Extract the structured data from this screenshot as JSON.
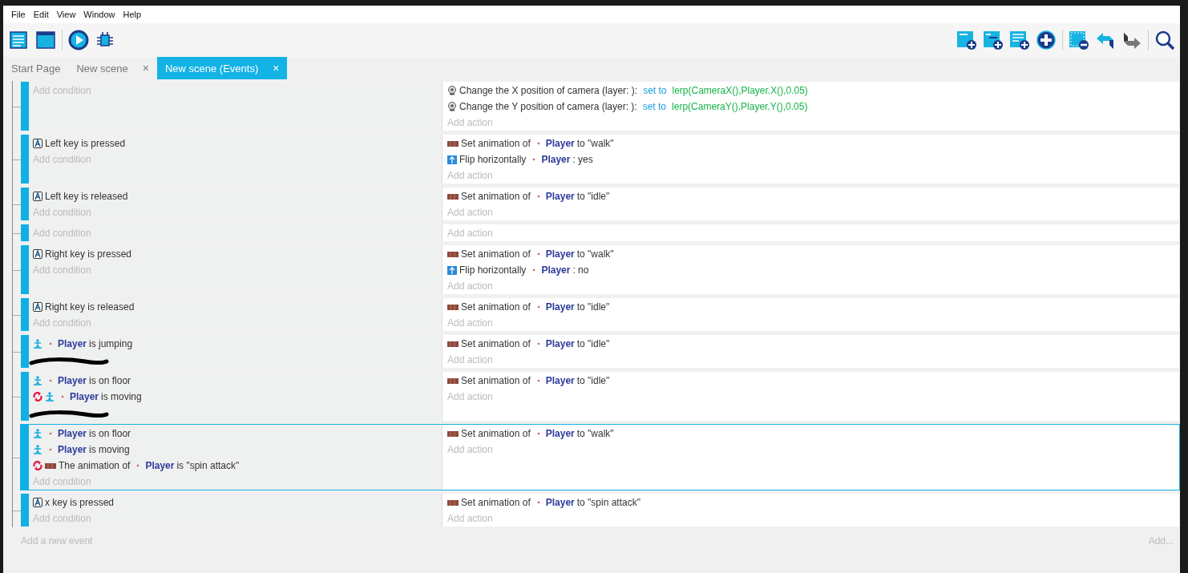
{
  "menu": [
    "File",
    "Edit",
    "View",
    "Window",
    "Help"
  ],
  "tabs": [
    {
      "label": "Start Page",
      "selected": false
    },
    {
      "label": "New scene",
      "selected": false,
      "close": "×"
    },
    {
      "label": "New scene (Events)",
      "selected": true,
      "close": "×"
    }
  ],
  "events": [
    {
      "selected": false,
      "add_condition": "Add condition",
      "add_action": "Add action",
      "actions": [
        {
          "kind": "camera",
          "before": "Change the X position of camera  (layer: ):",
          "operator": "set to",
          "value": "lerp(CameraX(),Player.X(),0.05)"
        },
        {
          "kind": "camera",
          "before": "Change the Y position of camera  (layer: ):",
          "operator": "set to",
          "value": "lerp(CameraY(),Player.Y(),0.05)"
        }
      ]
    },
    {
      "selected": false,
      "add_condition": "Add condition",
      "add_action": "Add action",
      "conditions": [
        {
          "kind": "key",
          "before": "Left key is pressed"
        }
      ],
      "actions": [
        {
          "kind": "animation",
          "before": "Set animation of",
          "object": "Player",
          "after": "to \"walk\""
        },
        {
          "kind": "flip",
          "before": "Flip horizontally",
          "object": "Player",
          "after": ": yes"
        }
      ]
    },
    {
      "selected": false,
      "add_condition": "Add condition",
      "add_action": "Add action",
      "conditions": [
        {
          "kind": "key",
          "before": "Left key is released"
        }
      ],
      "actions": [
        {
          "kind": "animation",
          "before": "Set animation of",
          "object": "Player",
          "after": "to \"idle\""
        }
      ]
    },
    {
      "selected": false,
      "add_condition": "Add condition",
      "add_action": "Add action"
    },
    {
      "selected": false,
      "add_condition": "Add condition",
      "add_action": "Add action",
      "conditions": [
        {
          "kind": "key",
          "before": "Right key is pressed"
        }
      ],
      "actions": [
        {
          "kind": "animation",
          "before": "Set animation of",
          "object": "Player",
          "after": "to \"walk\""
        },
        {
          "kind": "flip",
          "before": "Flip horizontally",
          "object": "Player",
          "after": ": no"
        }
      ]
    },
    {
      "selected": false,
      "add_condition": "Add condition",
      "add_action": "Add action",
      "conditions": [
        {
          "kind": "key",
          "before": "Right key is released"
        }
      ],
      "actions": [
        {
          "kind": "animation",
          "before": "Set animation of",
          "object": "Player",
          "after": "to \"idle\""
        }
      ]
    },
    {
      "selected": false,
      "scribble": true,
      "add_action": "Add action",
      "conditions": [
        {
          "kind": "object",
          "object": "Player",
          "after": "is jumping"
        }
      ],
      "actions": [
        {
          "kind": "animation",
          "before": "Set animation of",
          "object": "Player",
          "after": "to \"idle\""
        }
      ]
    },
    {
      "selected": false,
      "scribble": true,
      "add_action": "Add action",
      "conditions": [
        {
          "kind": "object",
          "object": "Player",
          "after": "is on floor"
        },
        {
          "kind": "object",
          "inverted": true,
          "object": "Player",
          "after": "is moving"
        }
      ],
      "actions": [
        {
          "kind": "animation",
          "before": "Set animation of",
          "object": "Player",
          "after": "to \"idle\""
        }
      ]
    },
    {
      "selected": true,
      "add_condition": "Add condition",
      "add_action": "Add action",
      "conditions": [
        {
          "kind": "object",
          "object": "Player",
          "after": "is on floor"
        },
        {
          "kind": "object",
          "object": "Player",
          "after": "is moving"
        },
        {
          "kind": "animation",
          "inverted": true,
          "before": "The animation of",
          "object": "Player",
          "after": "is \"spin attack\""
        }
      ],
      "actions": [
        {
          "kind": "animation",
          "before": "Set animation of",
          "object": "Player",
          "after": "to \"walk\""
        }
      ]
    },
    {
      "selected": false,
      "add_condition": "Add condition",
      "add_action": "Add action",
      "conditions": [
        {
          "kind": "key",
          "before": "x key is pressed"
        }
      ],
      "actions": [
        {
          "kind": "animation",
          "before": "Set animation of",
          "object": "Player",
          "after": "to \"spin attack\""
        }
      ]
    }
  ],
  "add_event": "Add a new event",
  "add_more": "Add..."
}
